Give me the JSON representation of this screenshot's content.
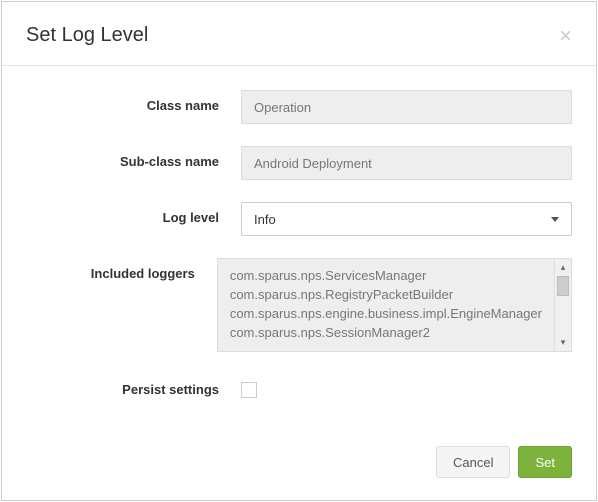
{
  "dialog": {
    "title": "Set Log Level"
  },
  "form": {
    "className": {
      "label": "Class name",
      "value": "Operation"
    },
    "subClassName": {
      "label": "Sub-class name",
      "value": "Android Deployment"
    },
    "logLevel": {
      "label": "Log level",
      "value": "Info"
    },
    "includedLoggers": {
      "label": "Included loggers",
      "value": "com.sparus.nps.ServicesManager\ncom.sparus.nps.RegistryPacketBuilder\ncom.sparus.nps.engine.business.impl.EngineManager\ncom.sparus.nps.SessionManager2"
    },
    "persistSettings": {
      "label": "Persist settings",
      "checked": false
    }
  },
  "footer": {
    "cancel": "Cancel",
    "set": "Set"
  }
}
